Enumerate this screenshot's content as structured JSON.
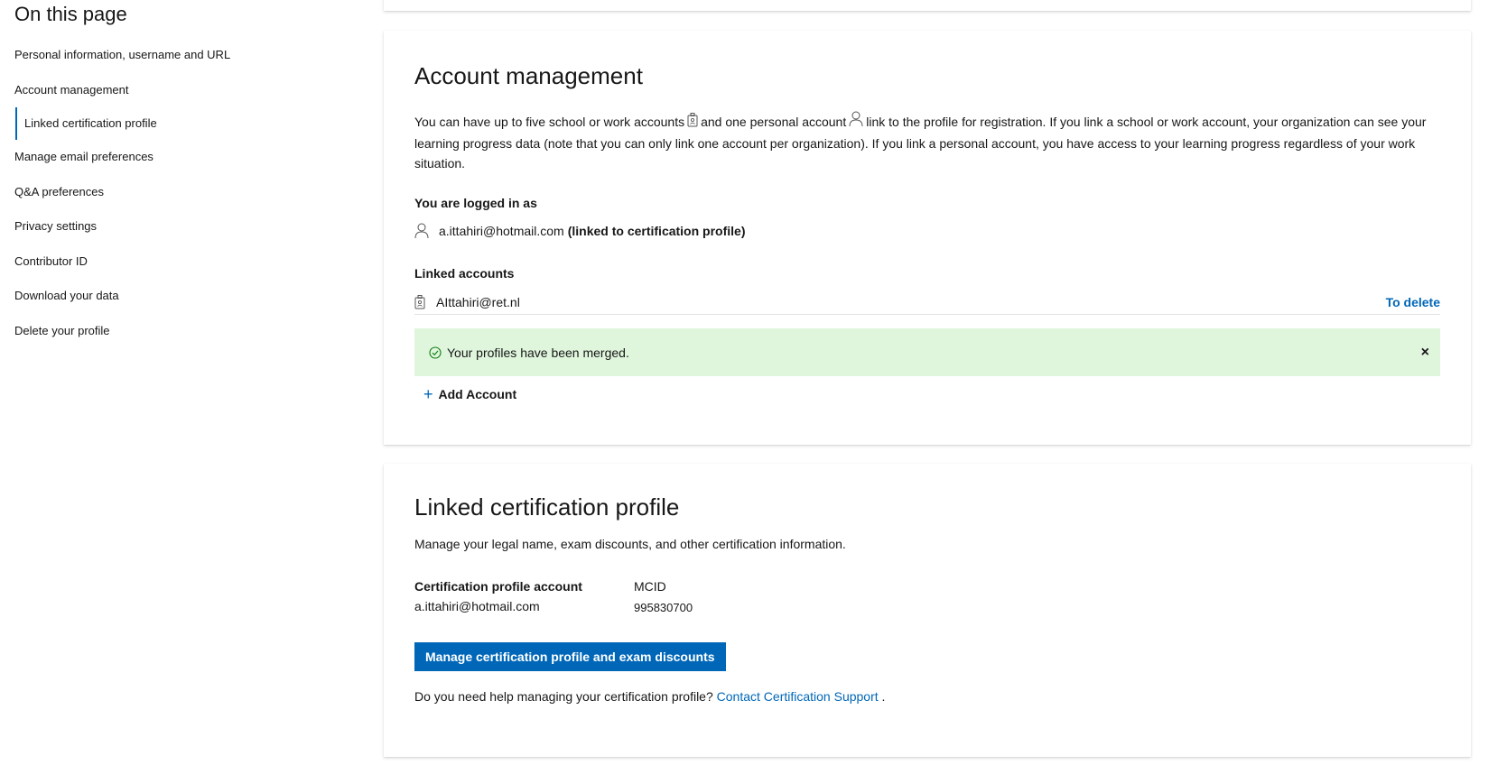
{
  "sidebar": {
    "title": "On this page",
    "items": [
      {
        "label": "Personal information, username and URL"
      },
      {
        "label": "Account management"
      },
      {
        "label": "Linked certification profile"
      },
      {
        "label": "Manage email preferences"
      },
      {
        "label": "Q&A preferences"
      },
      {
        "label": "Privacy settings"
      },
      {
        "label": "Contributor ID"
      },
      {
        "label": "Download your data"
      },
      {
        "label": "Delete your profile"
      }
    ]
  },
  "account": {
    "title": "Account management",
    "intro_part1": "You can have up to five school or work accounts",
    "intro_part2": "and one personal account",
    "intro_part3": "link to the profile for registration. If you link a school or work account, your organization can see your learning progress data (note that you can only link one account per organization). If you link a personal account, you have access to your learning progress regardless of your work situation.",
    "logged_in_label": "You are logged in as",
    "logged_in_email": "a.ittahiri@hotmail.com",
    "logged_in_note": "(linked to certification profile)",
    "linked_label": "Linked accounts",
    "linked_email": "AIttahiri@ret.nl",
    "delete_label": "To delete",
    "alert_text": "Your profiles have been merged.",
    "alert_close": "×",
    "add_label": "Add Account"
  },
  "cert": {
    "title": "Linked certification profile",
    "desc": "Manage your legal name, exam discounts, and other certification information.",
    "col1_label": "Certification profile account",
    "col1_value": "a.ittahiri@hotmail.com",
    "col2_label": "MCID",
    "col2_value": "995830700",
    "button_label": "Manage certification profile and exam discounts",
    "help_text": "Do you need help managing your certification profile?",
    "help_link": "Contact Certification Support",
    "help_end": "."
  },
  "colors": {
    "accent": "#0067b8",
    "success_bg": "#dff6dd",
    "success_icon": "#107c10"
  }
}
